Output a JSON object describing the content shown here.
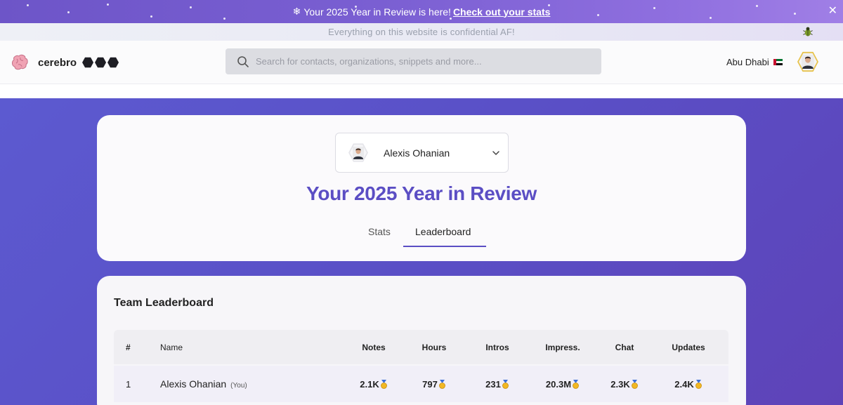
{
  "banner": {
    "icon": "snowflake-icon",
    "message": "Your 2025 Year in Review is here!",
    "link": "Check out your stats",
    "close": "✕"
  },
  "notice": {
    "text": "Everything on this website is confidential AF!",
    "icon": "bug-icon"
  },
  "header": {
    "brand": "cerebro",
    "search_placeholder": "Search for contacts, organizations, snippets and more...",
    "location": "Abu Dhabi",
    "flag": "uae-flag-icon"
  },
  "review": {
    "selected_person": "Alexis Ohanian",
    "title": "Your 2025 Year in Review",
    "tabs": [
      {
        "label": "Stats",
        "active": false
      },
      {
        "label": "Leaderboard",
        "active": true
      }
    ]
  },
  "leaderboard": {
    "title": "Team Leaderboard",
    "columns": [
      "#",
      "Name",
      "Notes",
      "Hours",
      "Intros",
      "Impress.",
      "Chat",
      "Updates"
    ],
    "rows": [
      {
        "rank": "1",
        "name": "Alexis Ohanian",
        "tag": "(You)",
        "notes": "2.1K",
        "hours": "797",
        "intros": "231",
        "impress": "20.3M",
        "chat": "2.3K",
        "updates": "2.4K"
      }
    ]
  },
  "colors": {
    "accent": "#5b4ec4",
    "banner_start": "#6d55c8",
    "background": "#5a4fc6"
  }
}
